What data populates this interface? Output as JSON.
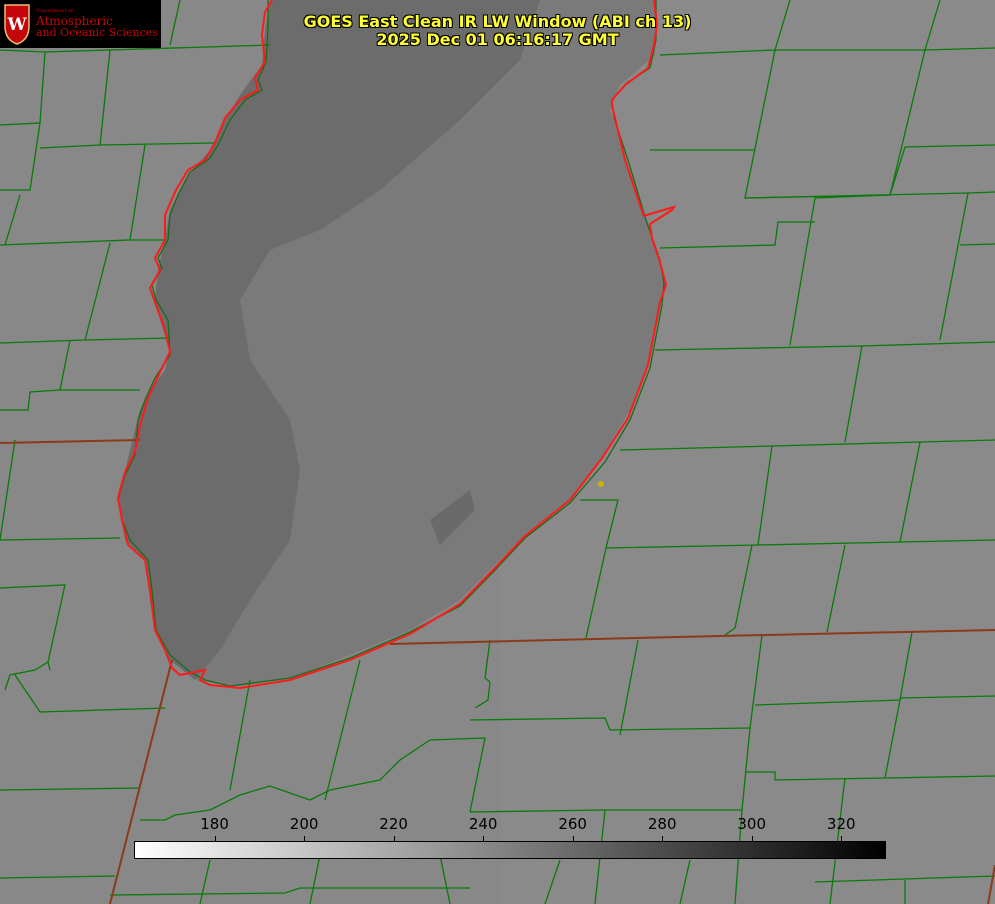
{
  "title": {
    "line1": "GOES East Clean IR LW Window (ABI ch 13)",
    "line2": "2025 Dec 01 06:16:17 GMT"
  },
  "logo": {
    "department": "Department of",
    "line1": "Atmospheric",
    "line2": "and Oceanic Sciences",
    "seal_letter": "W"
  },
  "colorbar": {
    "ticks": [
      "180",
      "200",
      "220",
      "240",
      "260",
      "280",
      "300",
      "320"
    ],
    "range": [
      162,
      330
    ],
    "gradient": [
      "#ffffff",
      "#000000"
    ]
  },
  "colors": {
    "land": "#8a8a8a",
    "lake": "#787878",
    "lake_west": "#6e6e6e",
    "county_lines": "#0a7a0a",
    "state_lines": "#8b3a1a",
    "shoreline": "#ff1a1a",
    "title": "#ffff33",
    "marker": "#c8b400",
    "logo_text": "#c5050c"
  }
}
